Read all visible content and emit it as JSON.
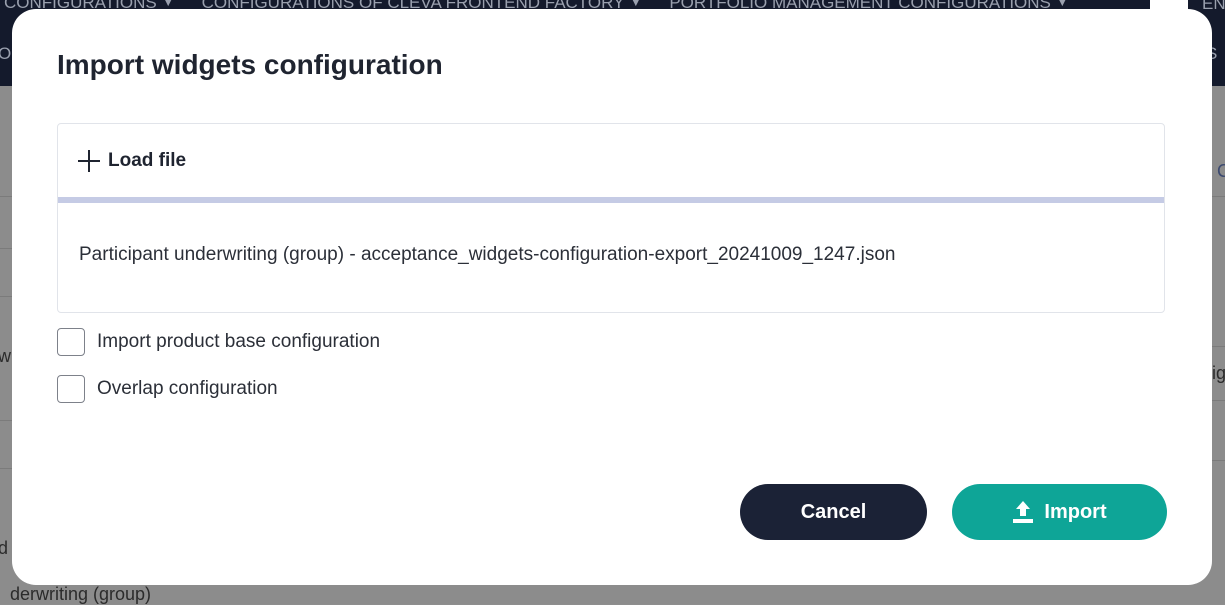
{
  "background": {
    "nav_items": [
      "CONFIGURATIONS",
      "CONFIGURATIONS OF CLEVA FRONTEND FACTORY",
      "PORTFOLIO MANAGEMENT CONFIGURATIONS"
    ],
    "language": "EN",
    "nav2_left": "O",
    "nav2_right": "S",
    "left_text_1": "w",
    "left_text_2": "d",
    "bottom_text": "derwriting (group)",
    "right_text_1": "C",
    "right_text_2": "ig"
  },
  "modal": {
    "title": "Import widgets configuration",
    "load_file_label": "Load file",
    "progress": 1.0,
    "file_name": "Participant underwriting (group) - acceptance_widgets-configuration-export_20241009_1247.json",
    "options": [
      {
        "label": "Import product base configuration",
        "checked": false
      },
      {
        "label": "Overlap configuration",
        "checked": false
      }
    ],
    "cancel_label": "Cancel",
    "import_label": "Import",
    "colors": {
      "cancel": "#1b2236",
      "import": "#0ea597",
      "progress": "#c5cbe5"
    }
  },
  "icons": [
    "plus-icon",
    "upload-icon",
    "caret-down-icon",
    "flag-icon"
  ]
}
